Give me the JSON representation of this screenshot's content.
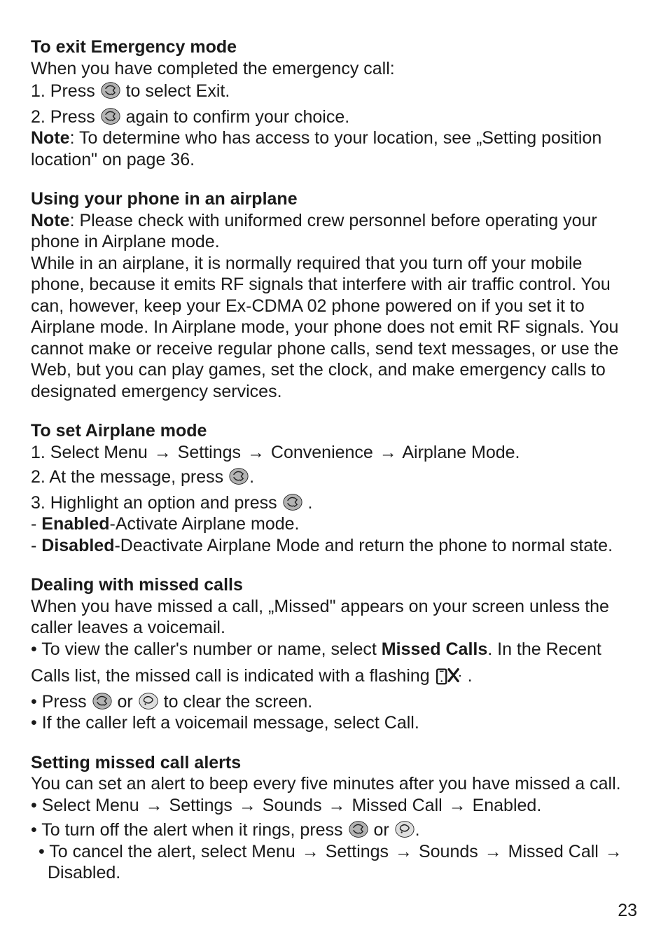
{
  "icons": {
    "ok_key": "ok-button-icon",
    "end_key": "end-button-icon",
    "missed_call": "missed-call-icon"
  },
  "sec1": {
    "title": "To exit Emergency mode",
    "intro": "When you have completed the emergency call:",
    "step1_a": "1. Press ",
    "step1_b": " to select Exit.",
    "step2_a": "2. Press ",
    "step2_b": " again to confirm your choice.",
    "note_label": "Note",
    "note_rest": ": To determine who has access to your location, see „Setting position location\" on page 36."
  },
  "sec2": {
    "title": "Using your phone in an airplane",
    "note_label": "Note",
    "note_rest": ": Please check with uniformed crew personnel before operating your phone in Airplane mode.",
    "body": "While in an airplane, it is normally required that you turn off your mobile phone, because it emits RF signals that interfere with air traffic control. You can, however, keep your Ex-CDMA 02 phone powered on if you set it to Airplane mode. In Airplane mode, your phone does not emit RF signals. You cannot make or receive regular phone calls, send text messages, or use the Web, but you can play games, set the clock, and make emergency calls to designated emergency services."
  },
  "sec3": {
    "title": "To set Airplane mode",
    "step1_a": "1. Select Menu ",
    "arrow": "→",
    "step1_b": " Settings ",
    "step1_c": " Convenience ",
    "step1_d": " Airplane Mode.",
    "step2_a": "2. At the message, press ",
    "dot": ".",
    "step3_a": "3. Highlight an option and press ",
    "opt1_label": "Enabled",
    "opt1_rest": "-Activate Airplane mode.",
    "opt2_label": "Disabled",
    "opt2_rest": "-Deactivate Airplane Mode and return the phone to normal state."
  },
  "sec4": {
    "title": "Dealing with missed calls",
    "line1": "When you have missed a call, „Missed\" appears on your screen unless the caller leaves a voicemail.",
    "b1_a": "• To view the caller's number or name, select ",
    "b1_bold": "Missed Calls",
    "b1_b": ". In the Recent",
    "b1_c": "Calls list, the missed call is indicated with a flashing ",
    "dot": ".",
    "b2_a": "• Press ",
    "b2_mid": " or  ",
    "b2_b": " to clear the screen.",
    "b3": "• If the caller left a voicemail message, select Call."
  },
  "sec5": {
    "title": "Setting missed call alerts",
    "line1": "You can set an alert to beep every five minutes after you have missed a call.",
    "arrow": "→",
    "b1_a": "• Select Menu ",
    "b1_b": " Settings ",
    "b1_c": " Sounds ",
    "b1_d": " Missed Call ",
    "b1_e": " Enabled.",
    "b2_a": "• To turn off the alert when it rings, press  ",
    "b2_mid": " or  ",
    "dot": ".",
    "b3_a": "• To cancel the alert, select Menu ",
    "b3_b": " Settings ",
    "b3_c": " Sounds ",
    "b3_d": " Missed Call ",
    "b3_e": " Disabled."
  },
  "page_number": "23"
}
